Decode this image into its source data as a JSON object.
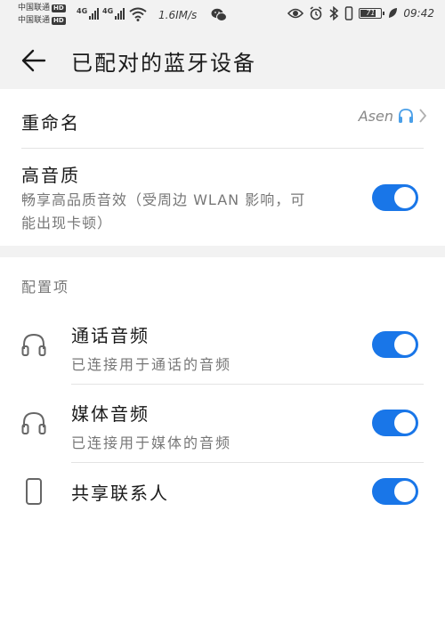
{
  "status_bar": {
    "carrier1": "中国联通",
    "carrier2": "中国联通",
    "hd1": "HD",
    "hd2": "HD",
    "net1": "4G",
    "net2": "4G",
    "speed": "1.6IM/s",
    "battery_level": "71",
    "time": "09:42"
  },
  "appbar": {
    "title": "已配对的蓝牙设备"
  },
  "rename": {
    "label": "重命名",
    "value": "Asen"
  },
  "hq": {
    "label": "高音质",
    "desc_line1": "畅享高品质音效（受周边 WLAN 影响，可",
    "desc_line2": "能出现卡顿）",
    "on": true
  },
  "config": {
    "header": "配置项",
    "items": [
      {
        "title": "通话音频",
        "sub": "已连接用于通话的音频",
        "icon": "headset-icon",
        "on": true
      },
      {
        "title": "媒体音频",
        "sub": "已连接用于媒体的音频",
        "icon": "headset-icon",
        "on": true
      },
      {
        "title": "共享联系人",
        "sub": "",
        "icon": "phone-icon",
        "on": true
      }
    ]
  },
  "colors": {
    "accent": "#1976e8",
    "band": "#f2f2f2"
  }
}
